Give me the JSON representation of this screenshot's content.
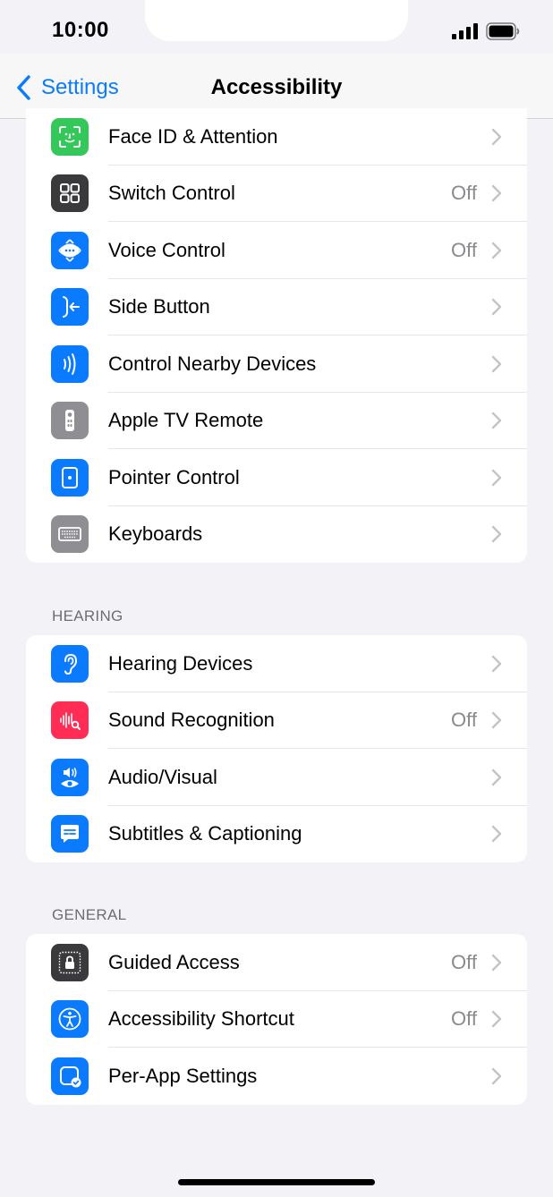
{
  "status_bar": {
    "time": "10:00"
  },
  "nav": {
    "back_label": "Settings",
    "title": "Accessibility"
  },
  "groups": [
    {
      "header": "",
      "items": [
        {
          "label": "Face ID & Attention",
          "value": "",
          "icon": "face-id-icon",
          "color": "#34c759"
        },
        {
          "label": "Switch Control",
          "value": "Off",
          "icon": "switch-control-icon",
          "color": "#3a3a3c"
        },
        {
          "label": "Voice Control",
          "value": "Off",
          "icon": "voice-control-icon",
          "color": "#0a7aff"
        },
        {
          "label": "Side Button",
          "value": "",
          "icon": "side-button-icon",
          "color": "#0a7aff"
        },
        {
          "label": "Control Nearby Devices",
          "value": "",
          "icon": "nearby-devices-icon",
          "color": "#0a7aff"
        },
        {
          "label": "Apple TV Remote",
          "value": "",
          "icon": "tv-remote-icon",
          "color": "#8e8e93"
        },
        {
          "label": "Pointer Control",
          "value": "",
          "icon": "pointer-control-icon",
          "color": "#0a7aff"
        },
        {
          "label": "Keyboards",
          "value": "",
          "icon": "keyboard-icon",
          "color": "#8e8e93"
        }
      ]
    },
    {
      "header": "HEARING",
      "items": [
        {
          "label": "Hearing Devices",
          "value": "",
          "icon": "ear-icon",
          "color": "#0a7aff"
        },
        {
          "label": "Sound Recognition",
          "value": "Off",
          "icon": "sound-recognition-icon",
          "color": "#ff2d55"
        },
        {
          "label": "Audio/Visual",
          "value": "",
          "icon": "audio-visual-icon",
          "color": "#0a7aff"
        },
        {
          "label": "Subtitles & Captioning",
          "value": "",
          "icon": "captions-icon",
          "color": "#0a7aff"
        }
      ]
    },
    {
      "header": "GENERAL",
      "items": [
        {
          "label": "Guided Access",
          "value": "Off",
          "icon": "lock-icon",
          "color": "#3a3a3c"
        },
        {
          "label": "Accessibility Shortcut",
          "value": "Off",
          "icon": "accessibility-icon",
          "color": "#0a7aff"
        },
        {
          "label": "Per-App Settings",
          "value": "",
          "icon": "per-app-icon",
          "color": "#0a7aff"
        }
      ]
    }
  ]
}
